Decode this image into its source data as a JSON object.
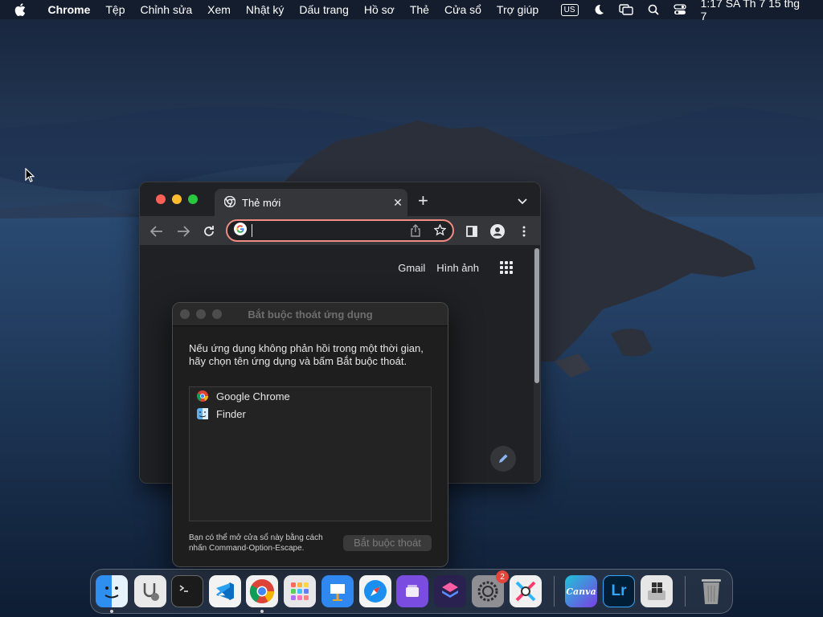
{
  "menubar": {
    "app_name": "Chrome",
    "items": [
      "Tệp",
      "Chỉnh sửa",
      "Xem",
      "Nhật ký",
      "Dấu trang",
      "Hồ sơ",
      "Thẻ",
      "Cửa sổ",
      "Trợ giúp"
    ],
    "input_source": "US",
    "clock": "1:17 SA Th 7 15 thg 7"
  },
  "chrome": {
    "tab_title": "Thẻ mới",
    "omnibox_value": "",
    "links": {
      "gmail": "Gmail",
      "images": "Hình ảnh"
    }
  },
  "force_quit": {
    "title": "Bắt buộc thoát ứng dụng",
    "message": "Nếu ứng dụng không phản hồi trong một thời gian, hãy chọn tên ứng dụng và bấm Bắt buộc thoát.",
    "apps": [
      {
        "name": "Google Chrome",
        "icon": "chrome-icon"
      },
      {
        "name": "Finder",
        "icon": "finder-icon"
      }
    ],
    "footer": "Bạn có thể mở cửa sổ này bằng cách nhấn Command-Option-Escape.",
    "button": "Bắt buộc thoát"
  },
  "dock": {
    "apps": [
      "finder",
      "system-information",
      "terminal",
      "vscode",
      "chrome",
      "launchpad",
      "keynote",
      "safari",
      "app-unknown-purple",
      "shortcuts",
      "system-settings",
      "instruments",
      "canva",
      "lightroom",
      "boot-camp",
      "trash"
    ],
    "icon_labels": {
      "canva": "Canva",
      "lightroom": "Lr"
    },
    "badge_system_settings": "2"
  }
}
